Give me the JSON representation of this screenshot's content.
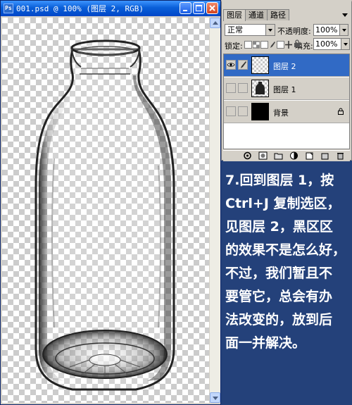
{
  "document": {
    "title": "001.psd @ 100% (图层 2, RGB)",
    "icon": "ps-document-icon"
  },
  "layers_panel": {
    "tabs": [
      {
        "label": "图层",
        "active": true
      },
      {
        "label": "通道",
        "active": false
      },
      {
        "label": "路径",
        "active": false
      }
    ],
    "blend_mode": "正常",
    "opacity_label": "不透明度:",
    "opacity_value": "100%",
    "lock_label": "锁定:",
    "fill_label": "填充:",
    "fill_value": "100%",
    "layers": [
      {
        "name": "图层 2",
        "visible": true,
        "selected": true,
        "thumbnail": "transparent",
        "locked": false
      },
      {
        "name": "图层 1",
        "visible": false,
        "selected": false,
        "thumbnail": "bottle",
        "locked": false
      },
      {
        "name": "背景",
        "visible": false,
        "selected": false,
        "thumbnail": "black",
        "locked": true
      }
    ],
    "bottom_icons": [
      "link-icon",
      "layer-style-icon",
      "mask-icon",
      "new-group-icon",
      "adjustment-layer-icon",
      "new-layer-icon",
      "trash-icon"
    ]
  },
  "caption": {
    "lines": [
      "7.回到图层 1，按",
      "Ctrl+J 复制选区，",
      "见图层 2，黑区区",
      "的效果不是怎么好，",
      "不过，我们暂且不",
      "要管它，总会有办",
      "法改变的，放到后",
      "面一并解决。"
    ]
  },
  "colors": {
    "background": "#24417a",
    "titlebar": "#0a5fd8",
    "selection": "#316ac5",
    "panel": "#d4d0c8"
  }
}
